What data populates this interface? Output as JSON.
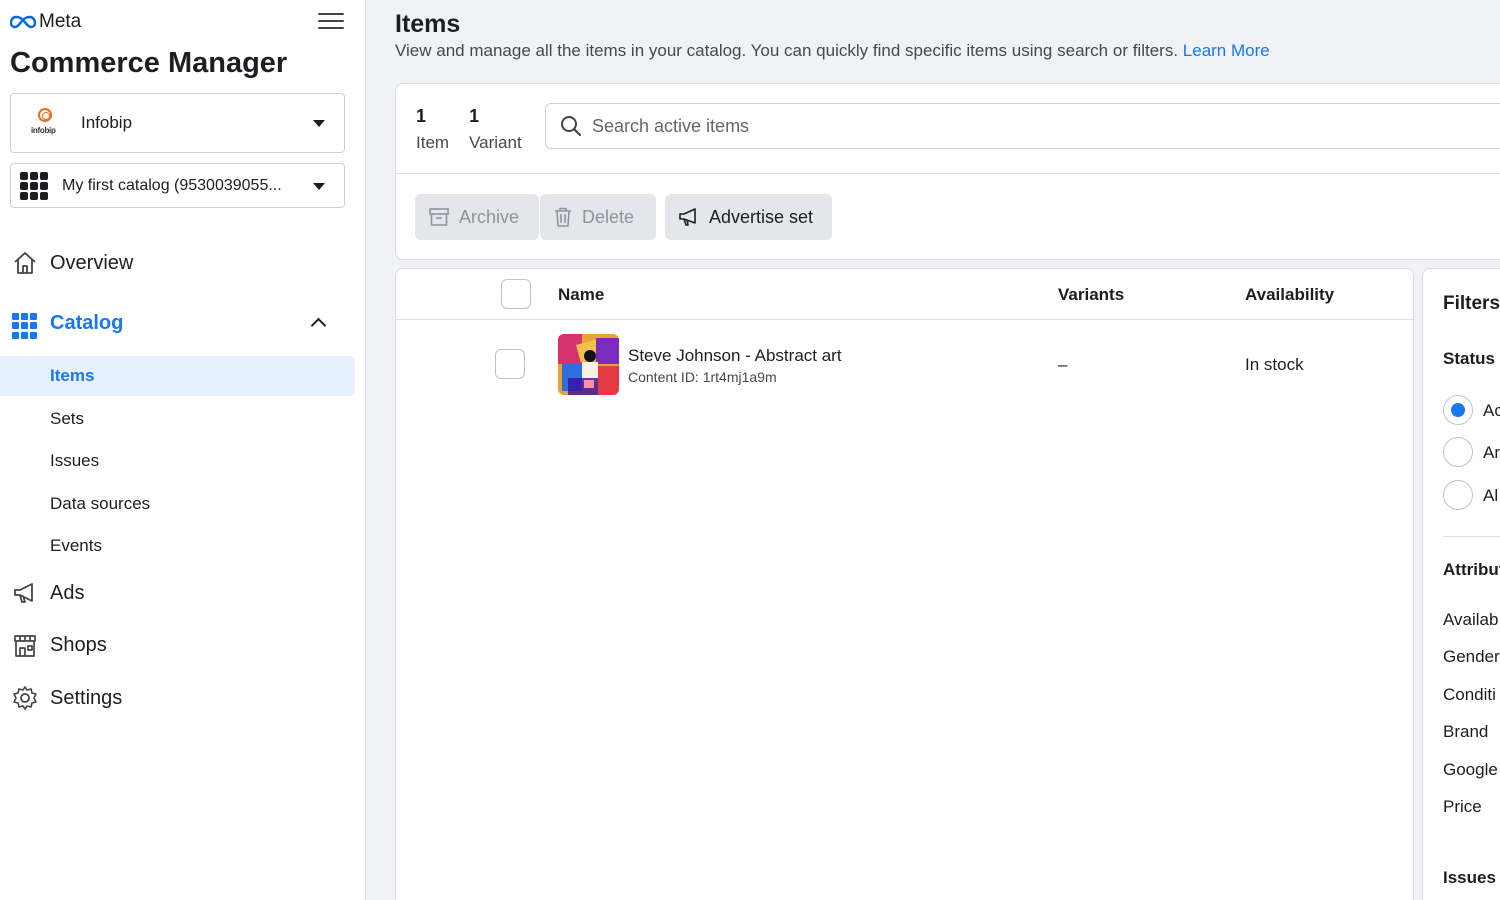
{
  "brand": {
    "logo_text": "Meta",
    "app_title": "Commerce Manager"
  },
  "business": {
    "logo_text": "infobip",
    "name": "Infobip"
  },
  "catalog_select": {
    "name": "My first catalog (9530039055..."
  },
  "nav": {
    "overview": "Overview",
    "catalog": "Catalog",
    "catalog_sub": [
      "Items",
      "Sets",
      "Issues",
      "Data sources",
      "Events"
    ],
    "ads": "Ads",
    "shops": "Shops",
    "settings": "Settings"
  },
  "page": {
    "title": "Items",
    "description": "View and manage all the items in your catalog. You can quickly find specific items using search or filters.",
    "learn_more": "Learn More"
  },
  "counts": [
    {
      "value": "1",
      "label": "Item"
    },
    {
      "value": "1",
      "label": "Variant"
    }
  ],
  "search": {
    "placeholder": "Search active items"
  },
  "actions": {
    "archive": "Archive",
    "delete": "Delete",
    "advertise": "Advertise set"
  },
  "table": {
    "columns": [
      "Name",
      "Variants",
      "Availability"
    ],
    "rows": [
      {
        "name": "Steve Johnson - Abstract art",
        "content_id": "Content ID: 1rt4mj1a9m",
        "variants": "–",
        "availability": "In stock"
      }
    ]
  },
  "filters": {
    "title": "Filters",
    "status_heading": "Status",
    "status_options": [
      "Ac",
      "Ar",
      "Al"
    ],
    "attributes_heading": "Attribut",
    "attributes": [
      "Availab",
      "Gender",
      "Conditi",
      "Brand",
      "Google",
      "Price"
    ],
    "issues_heading": "Issues"
  },
  "colors": {
    "accent": "#1877f2",
    "background": "#f0f2f5",
    "brand_orange": "#f26b21"
  }
}
